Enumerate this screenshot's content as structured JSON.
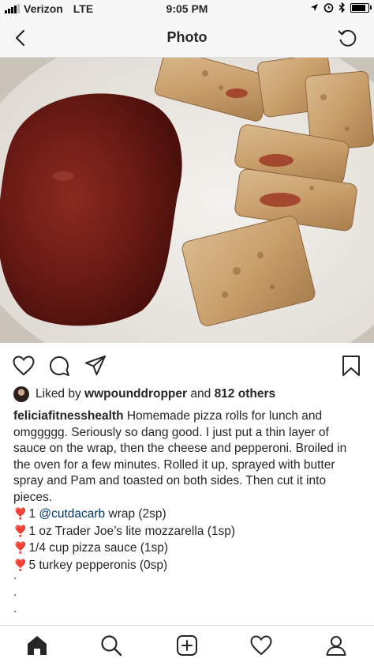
{
  "status_bar": {
    "carrier": "Verizon",
    "network": "LTE",
    "time": "9:05 PM"
  },
  "nav": {
    "title": "Photo",
    "back_icon": "chevron-left-icon",
    "refresh_icon": "refresh-icon"
  },
  "post": {
    "image_description_icon": "photo",
    "liked_by_prefix": "Liked by",
    "liked_by_user": "wwpounddropper",
    "liked_by_and": "and",
    "liked_by_others": "812 others",
    "username": "feliciafitnesshealth",
    "caption_text": "Homemade pizza rolls for lunch and omggggg. Seriously so dang good. I just put a thin layer of sauce on the wrap, then the cheese and pepperoni. Broiled in the oven for a few minutes. Rolled it up, sprayed with butter spray and Pam and toasted on both sides. Then cut it into pieces.",
    "ingredients": [
      {
        "prefix": "1 ",
        "mention": "@cutdacarb",
        "text": " wrap (2sp)"
      },
      {
        "prefix": "",
        "mention": "",
        "text": "1 oz Trader Joe’s lite mozzarella (1sp)"
      },
      {
        "prefix": "",
        "mention": "",
        "text": "1/4 cup pizza sauce (1sp)"
      },
      {
        "prefix": "",
        "mention": "",
        "text": "5 turkey pepperonis (0sp)"
      }
    ],
    "bullet_icon": "heart-exclamation-icon",
    "trailing_dots": [
      ".",
      ".",
      ".",
      "."
    ]
  },
  "tabbar": {
    "items": [
      "home-icon",
      "search-icon",
      "new-post-icon",
      "activity-heart-icon",
      "profile-icon"
    ]
  },
  "colors": {
    "text": "#262626",
    "mention": "#003569",
    "bullet": "#d0021b",
    "bar_bg": "#f7f7f7",
    "divider": "#dbdbdb"
  }
}
